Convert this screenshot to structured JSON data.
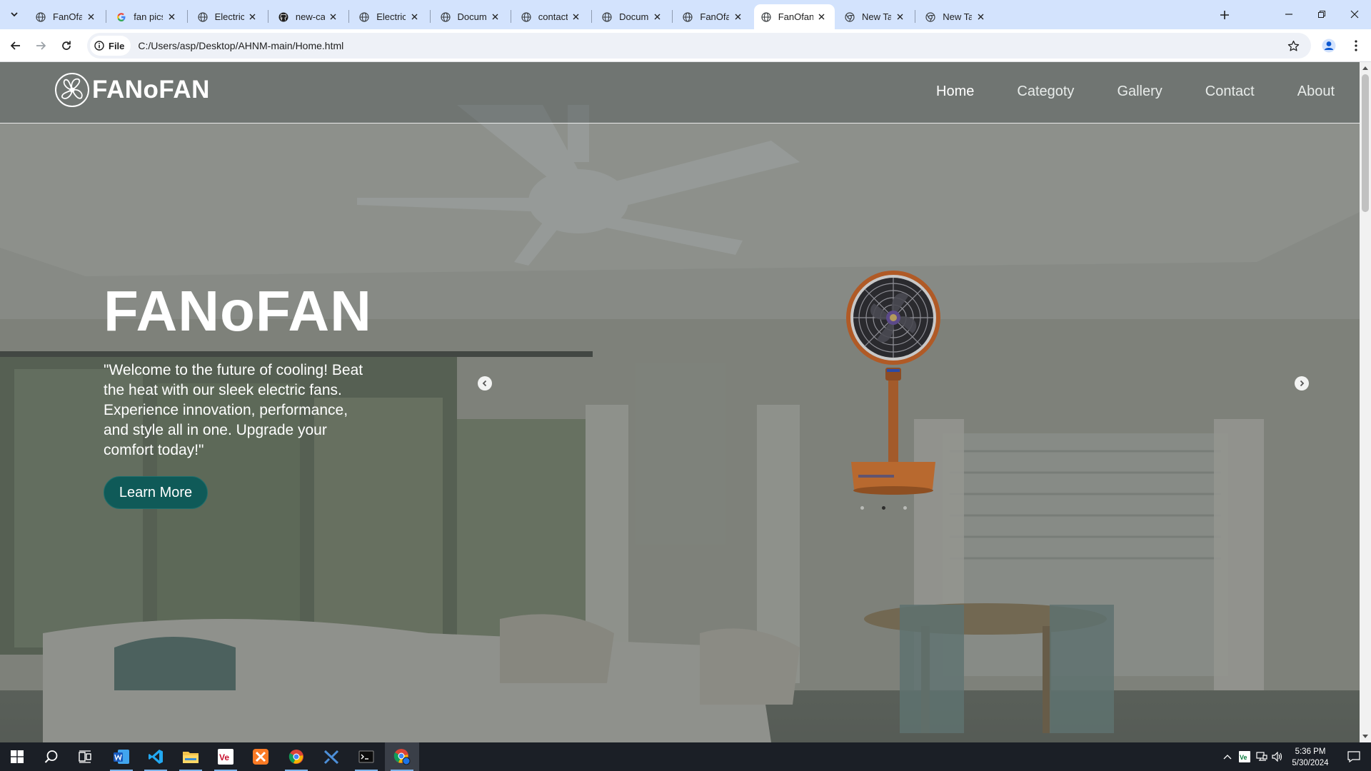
{
  "browser": {
    "tabs": [
      {
        "title": "FanOfan",
        "favicon": "globe-icon",
        "active": false
      },
      {
        "title": "fan pics - Go",
        "favicon": "google-icon",
        "active": false
      },
      {
        "title": "Electric Fan C",
        "favicon": "globe-icon",
        "active": false
      },
      {
        "title": "new-cards/c",
        "favicon": "github-icon",
        "active": false
      },
      {
        "title": "Electric Fan C",
        "favicon": "globe-icon",
        "active": false
      },
      {
        "title": "Document",
        "favicon": "globe-icon",
        "active": false
      },
      {
        "title": "contact us",
        "favicon": "globe-icon",
        "active": false
      },
      {
        "title": "Document",
        "favicon": "globe-icon",
        "active": false
      },
      {
        "title": "FanOfan",
        "favicon": "globe-icon",
        "active": false
      },
      {
        "title": "FanOfan",
        "favicon": "globe-icon",
        "active": true
      },
      {
        "title": "New Tab",
        "favicon": "chrome-icon",
        "active": false
      },
      {
        "title": "New Tab",
        "favicon": "chrome-icon",
        "active": false
      }
    ],
    "site_chip": "File",
    "url": "C:/Users/asp/Desktop/AHNM-main/Home.html"
  },
  "site": {
    "brand": "FANoFAN",
    "nav": {
      "home": "Home",
      "category": "Categoty",
      "gallery": "Gallery",
      "contact": "Contact",
      "about": "About"
    },
    "hero": {
      "title": "FANoFAN",
      "text": "\"Welcome to the future of cooling! Beat the heat with our sleek electric fans. Experience innovation, performance, and style all in one. Upgrade your comfort today!\"",
      "button": "Learn More"
    },
    "carousel": {
      "slides": 3,
      "active_index": 1
    }
  },
  "taskbar": {
    "apps": [
      "windows-start-icon",
      "search-icon",
      "task-view-icon",
      "word-icon",
      "vscode-icon",
      "file-explorer-icon",
      "vectorworks-icon",
      "xampp-icon",
      "chrome-icon",
      "visual-studio-icon",
      "terminal-icon",
      "chrome-profile-icon"
    ],
    "time": "5:36 PM",
    "date": "5/30/2024"
  },
  "colors": {
    "tabstrip": "#d3e3fd",
    "hero_button": "#0f5a58",
    "taskbar": "#1b1f26"
  }
}
